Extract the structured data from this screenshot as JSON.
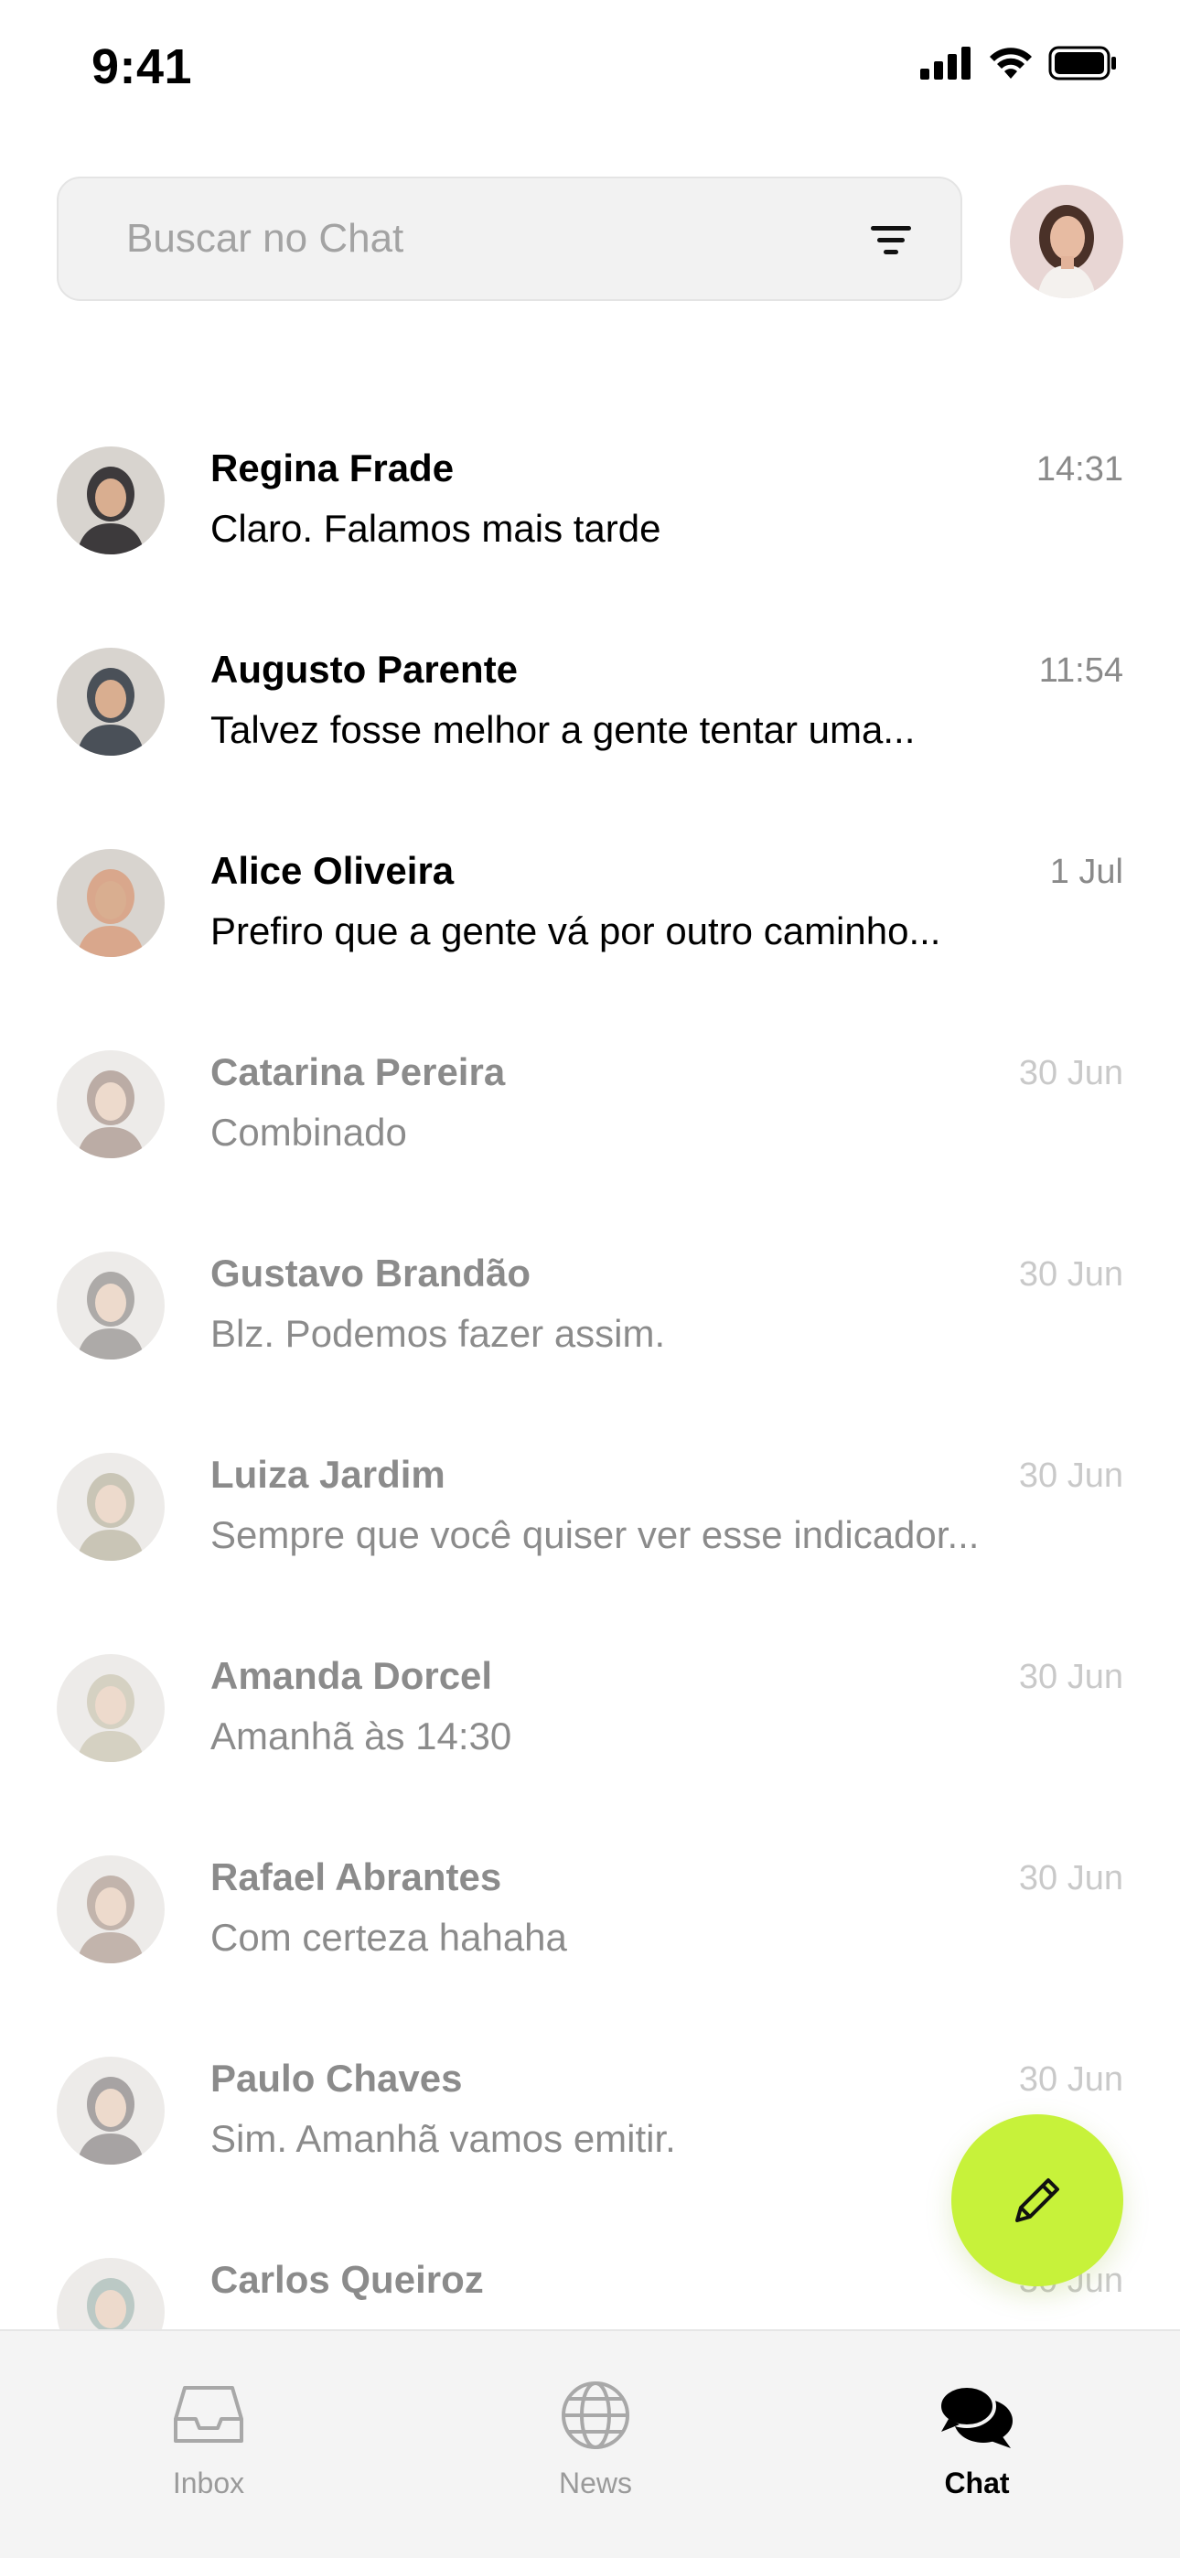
{
  "status_bar": {
    "time": "9:41",
    "icons": [
      "cellular-signal-icon",
      "wifi-icon",
      "battery-icon"
    ]
  },
  "search": {
    "placeholder": "Buscar no Chat",
    "filter_icon": "filter-icon"
  },
  "profile": {
    "avatar": "profile-avatar"
  },
  "chats": [
    {
      "name": "Regina Frade",
      "time": "14:31",
      "preview": "Claro. Falamos mais tarde",
      "unread": true,
      "avatar_color": "#3d3a3c"
    },
    {
      "name": "Augusto Parente",
      "time": "11:54",
      "preview": "Talvez fosse melhor a gente tentar uma...",
      "unread": true,
      "avatar_color": "#4a5058"
    },
    {
      "name": "Alice Oliveira",
      "time": "1 Jul",
      "preview": "Prefiro que a gente vá por outro caminho...",
      "unread": true,
      "avatar_color": "#d9a78c"
    },
    {
      "name": "Catarina Pereira",
      "time": "30 Jun",
      "preview": "Combinado",
      "unread": false,
      "avatar_color": "#6b4a3a"
    },
    {
      "name": "Gustavo Brandão",
      "time": "30 Jun",
      "preview": "Blz. Podemos fazer assim.",
      "unread": false,
      "avatar_color": "#4c4440"
    },
    {
      "name": "Luiza Jardim",
      "time": "30 Jun",
      "preview": "Sempre que você quiser ver esse indicador...",
      "unread": false,
      "avatar_color": "#8a8060"
    },
    {
      "name": "Amanda Dorcel",
      "time": "30 Jun",
      "preview": "Amanhã às 14:30",
      "unread": false,
      "avatar_color": "#a49a7a"
    },
    {
      "name": "Rafael Abrantes",
      "time": "30 Jun",
      "preview": "Com certeza hahaha",
      "unread": false,
      "avatar_color": "#7a5a4a"
    },
    {
      "name": "Paulo Chaves",
      "time": "30 Jun",
      "preview": "Sim. Amanhã vamos emitir.",
      "unread": false,
      "avatar_color": "#3e3434"
    },
    {
      "name": "Carlos Queiroz",
      "time": "30 Jun",
      "preview": "",
      "unread": false,
      "avatar_color": "#6a8a80"
    }
  ],
  "fab": {
    "icon": "pencil-icon"
  },
  "tabs": [
    {
      "label": "Inbox",
      "icon": "inbox-tray-icon",
      "active": false
    },
    {
      "label": "News",
      "icon": "globe-icon",
      "active": false
    },
    {
      "label": "Chat",
      "icon": "chat-bubbles-icon",
      "active": true
    }
  ],
  "colors": {
    "accent": "#c7f23a",
    "text_primary": "#000000",
    "text_muted": "#8a8a8a",
    "search_bg": "#f2f2f2",
    "tab_bar_bg": "#f4f4f4"
  }
}
